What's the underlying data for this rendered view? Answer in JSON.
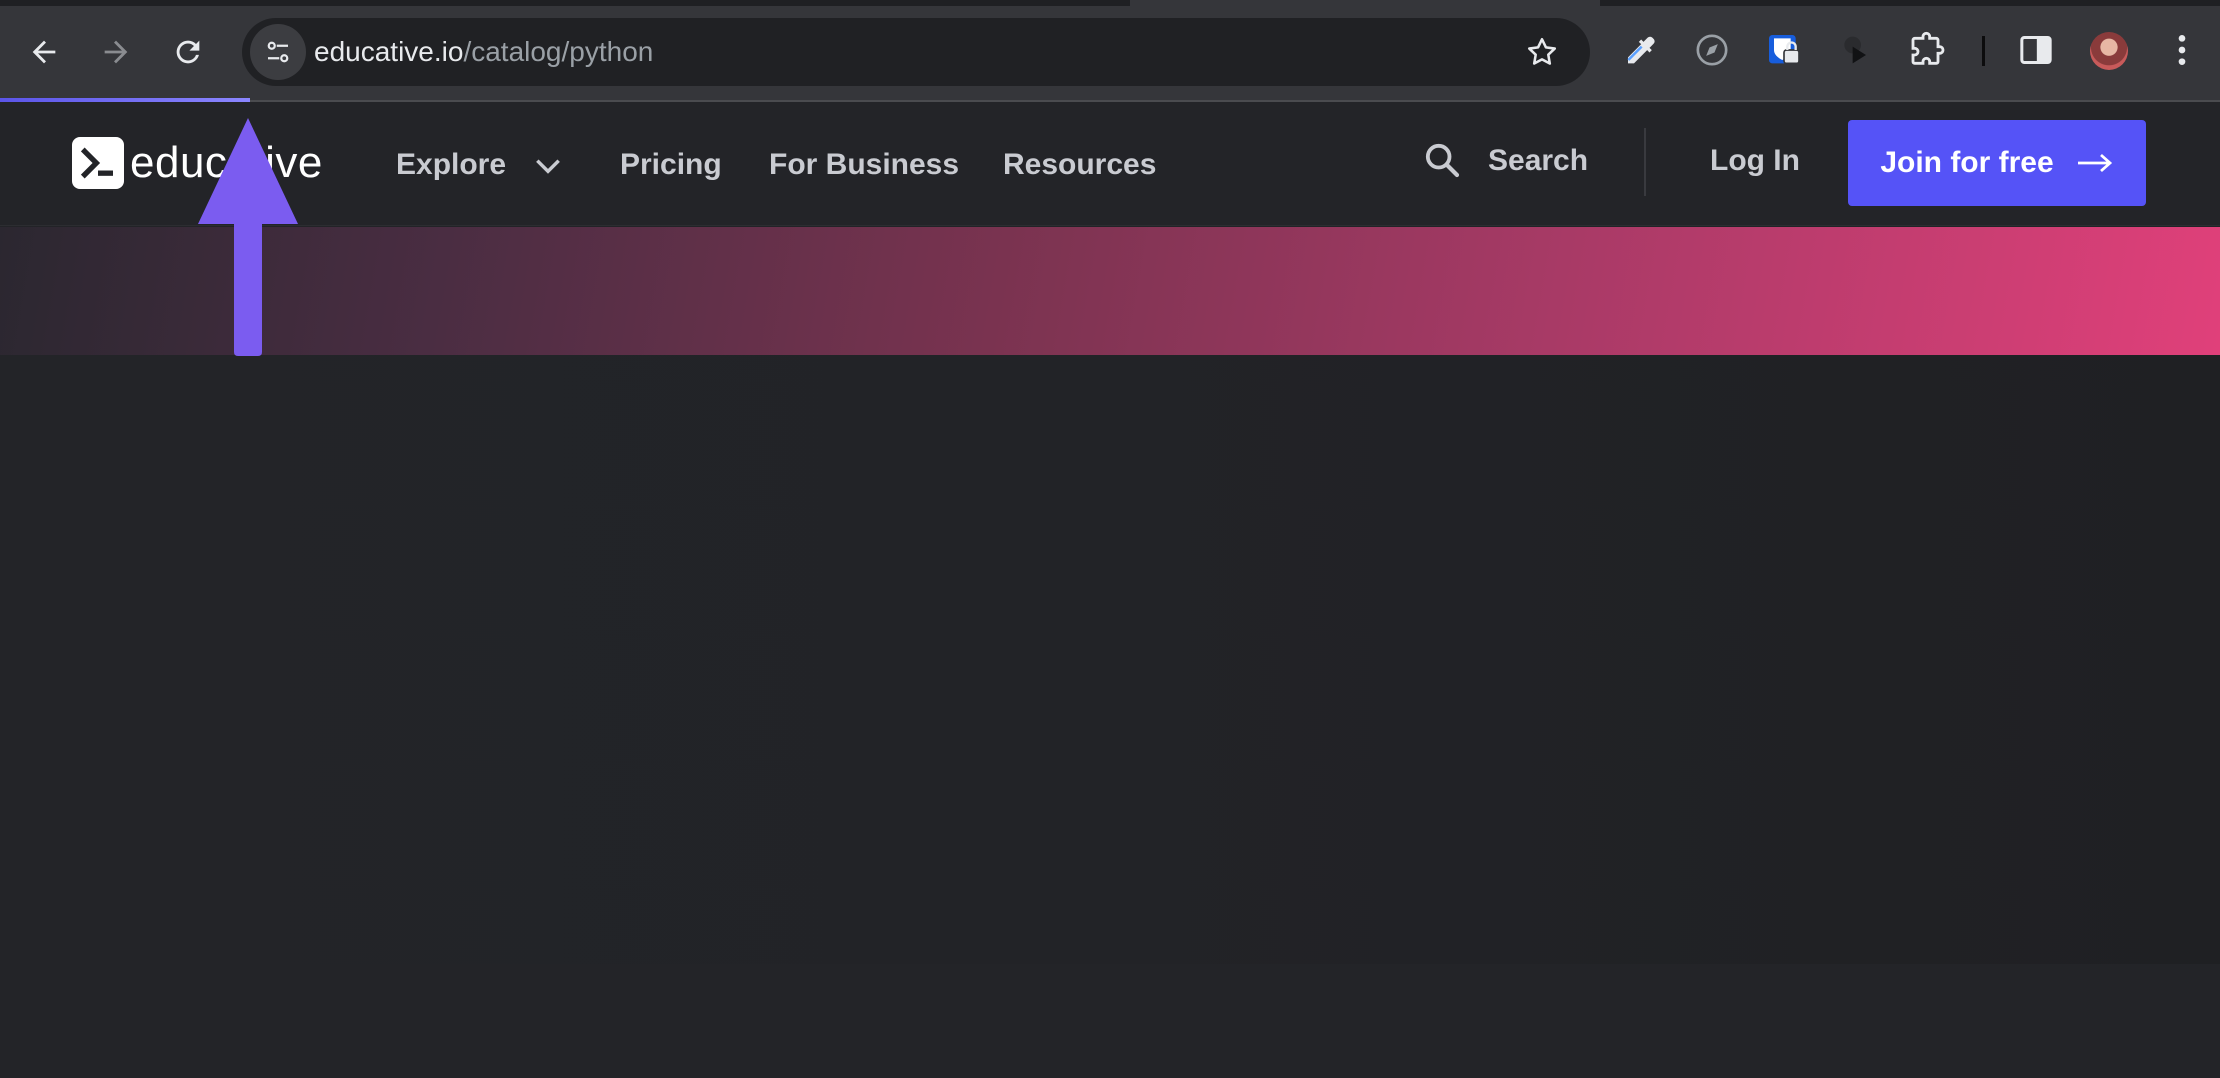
{
  "browser": {
    "url_domain": "educative.io",
    "url_path": "/catalog/python",
    "icons": [
      "back-icon",
      "forward-icon",
      "reload-icon",
      "site-info-icon",
      "bookmark-star-icon",
      "eyedropper-extension-icon",
      "compass-extension-icon",
      "password-manager-extension-icon",
      "media-extension-icon",
      "extensions-puzzle-icon",
      "side-panel-icon",
      "profile-avatar",
      "more-menu-icon"
    ]
  },
  "header": {
    "logo_text": "educative",
    "nav": {
      "explore": "Explore",
      "pricing": "Pricing",
      "for_business": "For Business",
      "resources": "Resources"
    },
    "search_label": "Search",
    "login_label": "Log In",
    "join_label": "Join for free"
  },
  "colors": {
    "accent": "#5553f7",
    "annotation_arrow": "#7b5cf0",
    "hero_gradient_start": "#2b2730",
    "hero_gradient_end": "#e0407a"
  }
}
